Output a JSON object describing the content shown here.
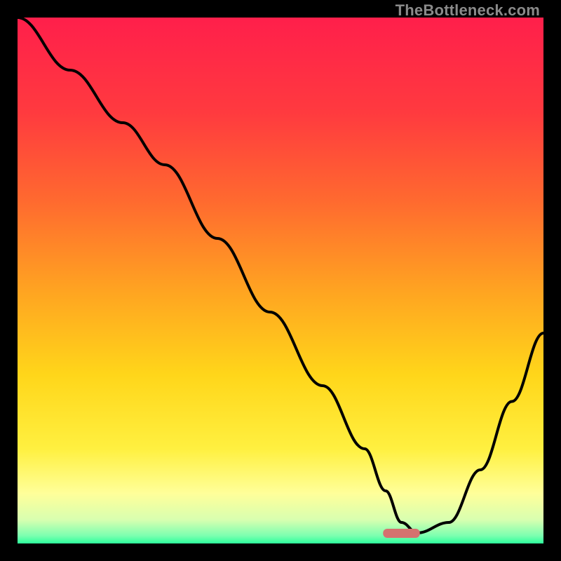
{
  "watermark": "TheBottleneck.com",
  "chart_data": {
    "type": "line",
    "title": "",
    "xlabel": "",
    "ylabel": "",
    "xlim": [
      0,
      100
    ],
    "ylim": [
      0,
      100
    ],
    "gradient_stops": [
      {
        "offset": 0,
        "color": "#ff1f4b"
      },
      {
        "offset": 0.18,
        "color": "#ff3a3f"
      },
      {
        "offset": 0.35,
        "color": "#ff6a2f"
      },
      {
        "offset": 0.52,
        "color": "#ffa421"
      },
      {
        "offset": 0.68,
        "color": "#ffd61a"
      },
      {
        "offset": 0.82,
        "color": "#fff040"
      },
      {
        "offset": 0.905,
        "color": "#ffff9a"
      },
      {
        "offset": 0.955,
        "color": "#d8ffb0"
      },
      {
        "offset": 0.985,
        "color": "#7dffb0"
      },
      {
        "offset": 1.0,
        "color": "#2dff9c"
      }
    ],
    "series": [
      {
        "name": "bottleneck-curve",
        "x": [
          0,
          10,
          20,
          28,
          38,
          48,
          58,
          66,
          70,
          73,
          76,
          82,
          88,
          94,
          100
        ],
        "y": [
          100,
          90,
          80,
          72,
          58,
          44,
          30,
          18,
          10,
          4,
          2,
          4,
          14,
          27,
          40
        ]
      }
    ],
    "marker": {
      "x": 73,
      "y": 2,
      "width_pct": 7,
      "color": "#d5736f"
    }
  }
}
